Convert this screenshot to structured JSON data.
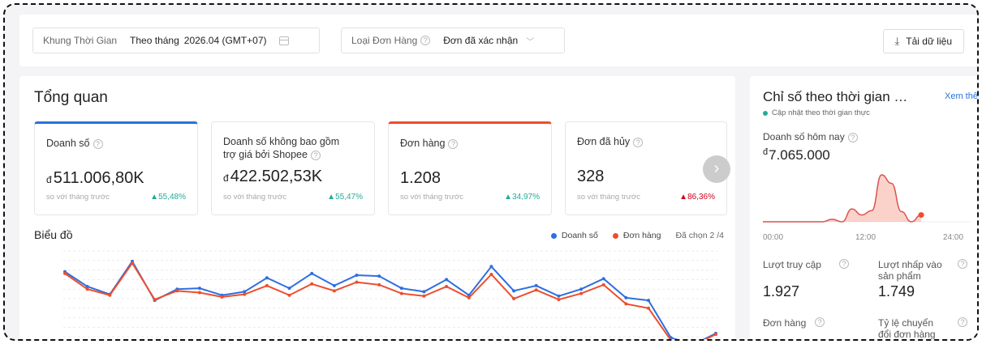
{
  "filters": {
    "period_label": "Khung Thời Gian",
    "period_mode": "Theo tháng",
    "period_value": "2026.04 (GMT+07)",
    "order_type_label": "Loại Đơn Hàng",
    "order_type_value": "Đơn đã xác nhận",
    "download_label": "Tải dữ liệu"
  },
  "overview": {
    "title": "Tổng quan",
    "currency_symbol": "đ",
    "compare_label": "so với tháng trước",
    "cards": [
      {
        "title": "Doanh số",
        "value": "511.006,80K",
        "delta": "55,48%",
        "trend": "up",
        "currency": true
      },
      {
        "title": "Doanh số không bao gồm trợ giá bởi Shopee",
        "value": "422.502,53K",
        "delta": "55,47%",
        "trend": "up",
        "currency": true
      },
      {
        "title": "Đơn hàng",
        "value": "1.208",
        "delta": "34,97%",
        "trend": "up",
        "currency": false
      },
      {
        "title": "Đơn đã hủy",
        "value": "328",
        "delta": "86,36%",
        "trend": "down",
        "currency": false
      }
    ]
  },
  "chart_section": {
    "title": "Biểu đồ",
    "selected_label": "Đã chọn 2 /4"
  },
  "chart_data": {
    "type": "line",
    "x": [
      1,
      2,
      3,
      4,
      5,
      6,
      7,
      8,
      9,
      10,
      11,
      12,
      13,
      14,
      15,
      16,
      17,
      18,
      19,
      20,
      21,
      22,
      23,
      24,
      25,
      26,
      27,
      28,
      29,
      30
    ],
    "series": [
      {
        "name": "Doanh số",
        "color": "#2f6fe0",
        "values": [
          86,
          69,
          60,
          98,
          53,
          66,
          67,
          59,
          63,
          79,
          67,
          84,
          70,
          82,
          81,
          67,
          63,
          77,
          59,
          92,
          64,
          70,
          58,
          66,
          78,
          56,
          53,
          10,
          2,
          15
        ]
      },
      {
        "name": "Đơn hàng",
        "color": "#ee4d2d",
        "values": [
          84,
          66,
          59,
          96,
          54,
          64,
          62,
          57,
          60,
          70,
          59,
          72,
          64,
          74,
          71,
          61,
          58,
          69,
          56,
          83,
          55,
          65,
          54,
          61,
          71,
          49,
          44,
          7,
          1,
          14
        ]
      }
    ],
    "ylim": [
      0,
      110
    ],
    "grid": true,
    "legend": "top-right"
  },
  "realtime": {
    "title": "Chỉ số theo thời gian …",
    "more_label": "Xem thêm",
    "live_label": "Cập nhật theo thời gian thực",
    "sales_today_label": "Doanh số hôm nay",
    "currency_symbol": "đ",
    "sales_today_value": "7.065.000",
    "ticks": [
      "00:00",
      "12:00",
      "24:00"
    ],
    "mini_chart": {
      "type": "area",
      "x": [
        0,
        1,
        2,
        3,
        4,
        5,
        6,
        7,
        8,
        9,
        10,
        11,
        12,
        13,
        14,
        15,
        16,
        17,
        18,
        19,
        20,
        21
      ],
      "values": [
        0,
        0,
        0,
        0,
        0,
        0,
        0,
        0.3,
        0,
        1.5,
        0.8,
        1.3,
        5.5,
        4.5,
        1.2,
        0,
        0.8,
        0.2,
        0,
        0,
        0,
        0
      ]
    },
    "metrics": {
      "visits_label": "Lượt truy cập",
      "visits_value": "1.927",
      "product_clicks_label": "Lượt nhấp vào sản phẩm",
      "product_clicks_value": "1.749",
      "orders_label": "Đơn hàng",
      "conversion_label": "Tỷ lệ chuyển đổi đơn hàng"
    }
  },
  "colors": {
    "accent_blue": "#2673dd",
    "accent_orange": "#ee4d2d",
    "trend_up": "#26aa99",
    "trend_down": "#d0021b"
  }
}
